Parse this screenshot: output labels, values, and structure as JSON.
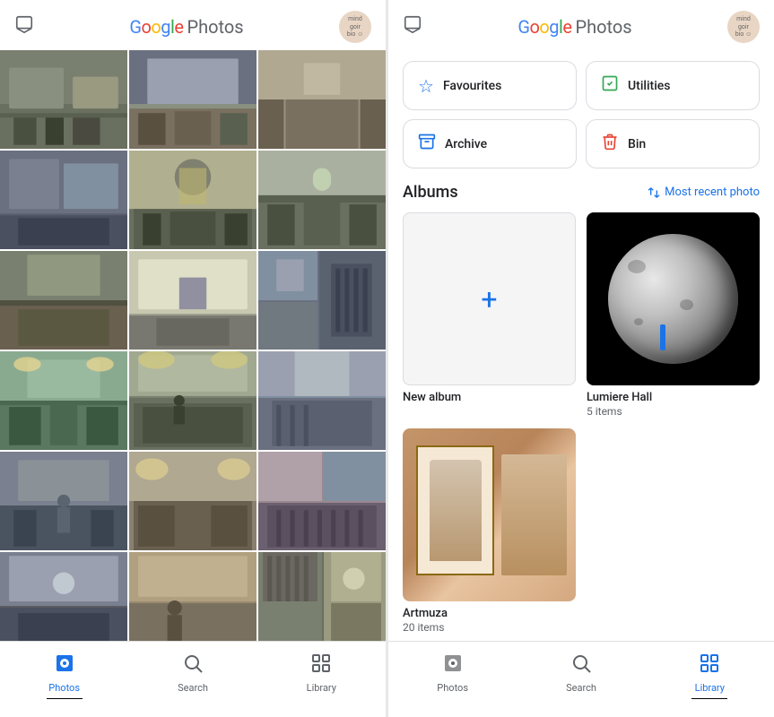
{
  "app": {
    "name": "Google Photos",
    "logo_letters": [
      {
        "char": "G",
        "color": "#4285F4"
      },
      {
        "char": "o",
        "color": "#EA4335"
      },
      {
        "char": "o",
        "color": "#FBBC04"
      },
      {
        "char": "g",
        "color": "#4285F4"
      },
      {
        "char": "l",
        "color": "#34A853"
      },
      {
        "char": "e",
        "color": "#EA4335"
      }
    ]
  },
  "left_screen": {
    "nav": {
      "items": [
        {
          "id": "photos",
          "label": "Photos",
          "active": true
        },
        {
          "id": "search",
          "label": "Search",
          "active": false
        },
        {
          "id": "library",
          "label": "Library",
          "active": false
        }
      ]
    },
    "grid_rows": 6,
    "photos_count": 18
  },
  "right_screen": {
    "quick_actions": [
      {
        "id": "favourites",
        "label": "Favourites",
        "icon": "★"
      },
      {
        "id": "utilities",
        "label": "Utilities",
        "icon": "✓"
      },
      {
        "id": "archive",
        "label": "Archive",
        "icon": "⊕"
      },
      {
        "id": "bin",
        "label": "Bin",
        "icon": "🗑"
      }
    ],
    "albums_section": {
      "title": "Albums",
      "most_recent_label": "Most recent photo"
    },
    "albums": [
      {
        "id": "new-album",
        "name": "New album",
        "count": null,
        "type": "new"
      },
      {
        "id": "lumiere-hall",
        "name": "Lumiere Hall",
        "count": "5 items",
        "type": "moon"
      },
      {
        "id": "artmuza",
        "name": "Artmuza",
        "count": "20 items",
        "type": "artmuza"
      }
    ],
    "nav": {
      "items": [
        {
          "id": "photos",
          "label": "Photos",
          "active": false
        },
        {
          "id": "search",
          "label": "Search",
          "active": false
        },
        {
          "id": "library",
          "label": "Library",
          "active": true
        }
      ]
    }
  }
}
